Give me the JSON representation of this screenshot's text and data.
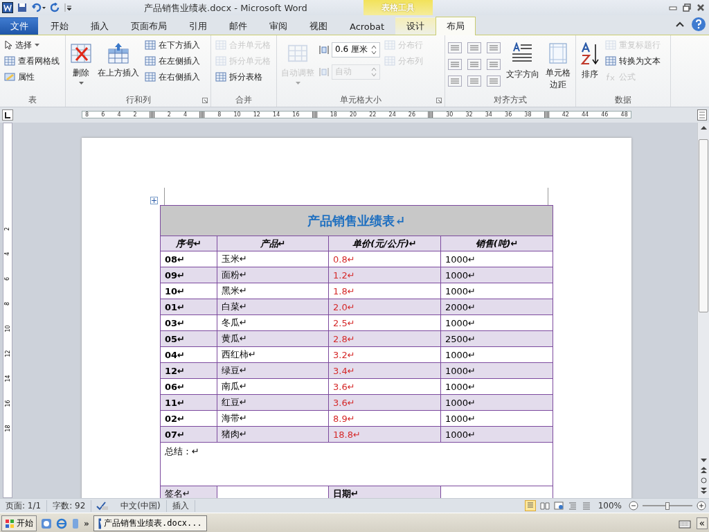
{
  "window": {
    "title": "产品销售业绩表.docx - Microsoft Word",
    "context_label": "表格工具"
  },
  "tabs": [
    {
      "label": "文件",
      "kind": "file",
      "selected": false
    },
    {
      "label": "开始",
      "kind": "normal",
      "selected": false
    },
    {
      "label": "插入",
      "kind": "normal",
      "selected": false
    },
    {
      "label": "页面布局",
      "kind": "normal",
      "selected": false
    },
    {
      "label": "引用",
      "kind": "normal",
      "selected": false
    },
    {
      "label": "邮件",
      "kind": "normal",
      "selected": false
    },
    {
      "label": "审阅",
      "kind": "normal",
      "selected": false
    },
    {
      "label": "视图",
      "kind": "normal",
      "selected": false
    },
    {
      "label": "Acrobat",
      "kind": "normal",
      "selected": false
    },
    {
      "label": "设计",
      "kind": "context",
      "selected": false
    },
    {
      "label": "布局",
      "kind": "context",
      "selected": true
    }
  ],
  "ribbon": {
    "groups": [
      {
        "label": "表",
        "launcher": false,
        "columns": [
          [
            {
              "kind": "small_menu",
              "label": "选择",
              "disabled": false
            },
            {
              "kind": "small",
              "label": "查看网格线",
              "disabled": false
            },
            {
              "kind": "small",
              "label": "属性",
              "disabled": false
            }
          ]
        ]
      },
      {
        "label": "行和列",
        "launcher": true,
        "columns": [
          [
            {
              "kind": "large_menu",
              "label": "删除",
              "disabled": false
            }
          ],
          [
            {
              "kind": "large",
              "label": "在上方插入",
              "disabled": false
            }
          ],
          [
            {
              "kind": "small",
              "label": "在下方插入",
              "disabled": false
            },
            {
              "kind": "small",
              "label": "在左侧插入",
              "disabled": false
            },
            {
              "kind": "small",
              "label": "在右侧插入",
              "disabled": false
            }
          ]
        ]
      },
      {
        "label": "合并",
        "launcher": false,
        "columns": [
          [
            {
              "kind": "small",
              "label": "合并单元格",
              "disabled": true
            },
            {
              "kind": "small",
              "label": "拆分单元格",
              "disabled": true
            },
            {
              "kind": "small",
              "label": "拆分表格",
              "disabled": false
            }
          ]
        ]
      },
      {
        "label": "单元格大小",
        "launcher": true,
        "columns": [
          [
            {
              "kind": "large_menu",
              "label": "自动调整",
              "disabled": true
            }
          ],
          [
            {
              "kind": "spin",
              "value": "0.6 厘米",
              "disabled": false
            },
            {
              "kind": "spin",
              "value": "自动",
              "disabled": true
            }
          ],
          [
            {
              "kind": "small",
              "label": "分布行",
              "disabled": true
            },
            {
              "kind": "small",
              "label": "分布列",
              "disabled": true
            }
          ]
        ]
      },
      {
        "label": "对齐方式",
        "launcher": false,
        "columns": [
          [
            {
              "kind": "align_grid",
              "disabled": false
            }
          ],
          [
            {
              "kind": "large",
              "label": "文字方向",
              "disabled": false
            }
          ],
          [
            {
              "kind": "large",
              "label": "单元格边距",
              "disabled": false
            }
          ]
        ]
      },
      {
        "label": "数据",
        "launcher": false,
        "columns": [
          [
            {
              "kind": "large",
              "label": "排序",
              "disabled": false
            }
          ],
          [
            {
              "kind": "small",
              "label": "重复标题行",
              "disabled": true
            },
            {
              "kind": "small",
              "label": "转换为文本",
              "disabled": false
            },
            {
              "kind": "small",
              "label": "公式",
              "disabled": true
            }
          ]
        ]
      }
    ]
  },
  "ruler": {
    "horizontal": [
      {
        "kind": "num",
        "label": "8"
      },
      {
        "kind": "num",
        "label": "6"
      },
      {
        "kind": "num",
        "label": "4"
      },
      {
        "kind": "num",
        "label": "2"
      },
      {
        "kind": "marker"
      },
      {
        "kind": "num",
        "label": "2"
      },
      {
        "kind": "num",
        "label": "4"
      },
      {
        "kind": "marker"
      },
      {
        "kind": "num",
        "label": "8"
      },
      {
        "kind": "num",
        "label": "10"
      },
      {
        "kind": "num",
        "label": "12"
      },
      {
        "kind": "num",
        "label": "14"
      },
      {
        "kind": "num",
        "label": "16"
      },
      {
        "kind": "marker"
      },
      {
        "kind": "num",
        "label": "18"
      },
      {
        "kind": "num",
        "label": "20"
      },
      {
        "kind": "num",
        "label": "22"
      },
      {
        "kind": "num",
        "label": "24"
      },
      {
        "kind": "num",
        "label": "26"
      },
      {
        "kind": "marker"
      },
      {
        "kind": "num",
        "label": "30"
      },
      {
        "kind": "num",
        "label": "32"
      },
      {
        "kind": "num",
        "label": "34"
      },
      {
        "kind": "num",
        "label": "36"
      },
      {
        "kind": "num",
        "label": "38"
      },
      {
        "kind": "marker"
      },
      {
        "kind": "num",
        "label": "42"
      },
      {
        "kind": "num",
        "label": "44"
      },
      {
        "kind": "num",
        "label": "46"
      },
      {
        "kind": "num",
        "label": "48"
      }
    ],
    "vertical": [
      "2",
      "4",
      "6",
      "8",
      "10",
      "12",
      "14",
      "16",
      "18"
    ]
  },
  "table": {
    "title": "产品销售业绩表↵",
    "columns": [
      "序号↵",
      "产品↵",
      "单价(元/公斤)↵",
      "销售(吨)↵"
    ],
    "rows": [
      [
        "08↵",
        "玉米↵",
        "0.8↵",
        "1000↵"
      ],
      [
        "09↵",
        "面粉↵",
        "1.2↵",
        "1000↵"
      ],
      [
        "10↵",
        "黑米↵",
        "1.8↵",
        "1000↵"
      ],
      [
        "01↵",
        "白菜↵",
        "2.0↵",
        "2000↵"
      ],
      [
        "03↵",
        "冬瓜↵",
        "2.5↵",
        "1000↵"
      ],
      [
        "05↵",
        "黄瓜↵",
        "2.8↵",
        "2500↵"
      ],
      [
        "04↵",
        "西红柿↵",
        "3.2↵",
        "1000↵"
      ],
      [
        "12↵",
        "绿豆↵",
        "3.4↵",
        "1000↵"
      ],
      [
        "06↵",
        "南瓜↵",
        "3.6↵",
        "1000↵"
      ],
      [
        "11↵",
        "红豆↵",
        "3.6↵",
        "1000↵"
      ],
      [
        "02↵",
        "海带↵",
        "8.9↵",
        "1000↵"
      ],
      [
        "07↵",
        "猪肉↵",
        "18.8↵",
        "1000↵"
      ]
    ],
    "summary": "总结：↵",
    "signature": [
      "签名↵",
      "日期↵"
    ]
  },
  "status_bar": {
    "page": "页面: 1/1",
    "words": "字数: 92",
    "language": "中文(中国)",
    "mode": "插入",
    "zoom": "100%",
    "level": 0.5
  },
  "taskbar": {
    "start": "开始",
    "overflow": "»",
    "task": "产品销售业绩表.docx...",
    "tray": "«"
  }
}
